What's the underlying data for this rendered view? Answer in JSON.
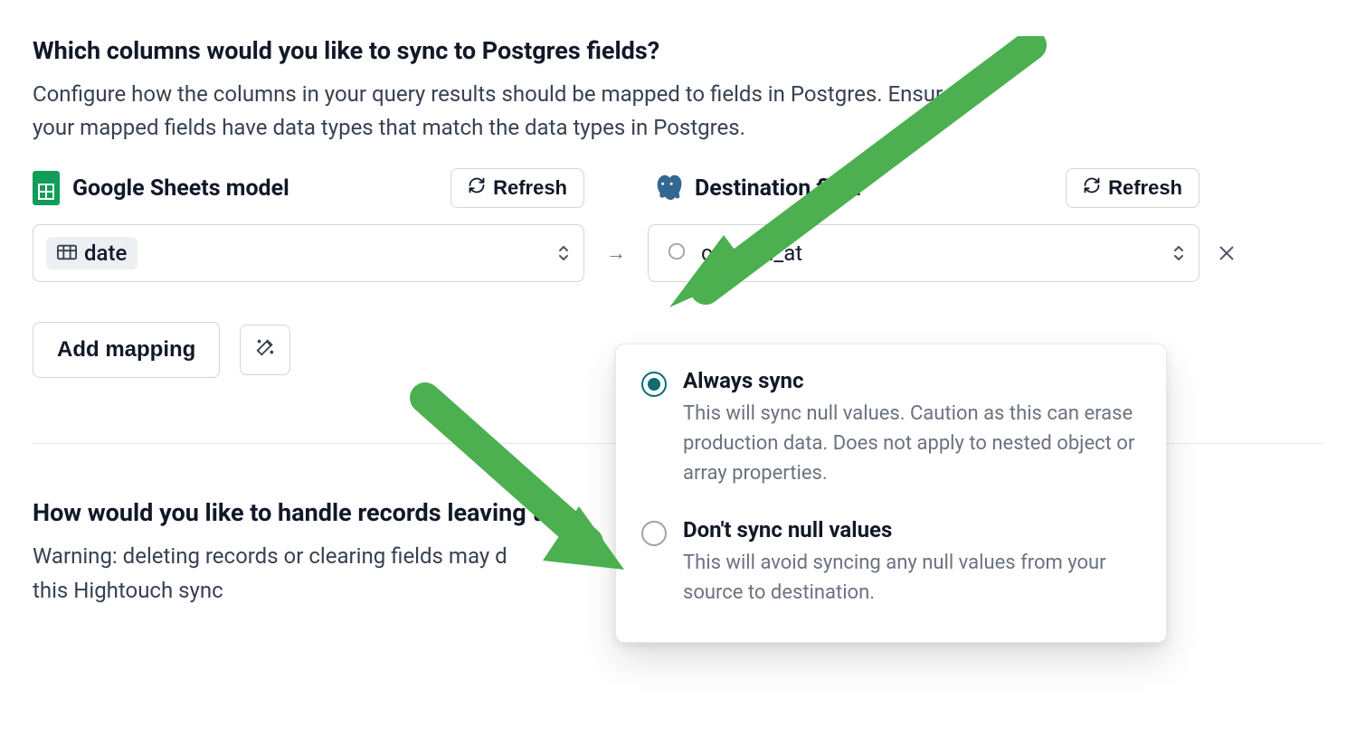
{
  "section1": {
    "heading": "Which columns would you like to sync to Postgres fields?",
    "description": "Configure how the columns in your query results should be mapped to fields in Postgres. Ensure your mapped fields have data types that match the data types in Postgres."
  },
  "source": {
    "label": "Google Sheets model",
    "refresh": "Refresh",
    "selected": "date"
  },
  "destination": {
    "label": "Destination field",
    "refresh": "Refresh",
    "selected": "created_at"
  },
  "actions": {
    "add_mapping": "Add mapping"
  },
  "sync_options": [
    {
      "title": "Always sync",
      "desc": "This will sync null values. Caution as this can erase production data. Does not apply to nested object or array properties.",
      "selected": true
    },
    {
      "title": "Don't sync null values",
      "desc": "This will avoid syncing any null values from your source to destination.",
      "selected": false
    }
  ],
  "section2": {
    "heading": "How would you like to handle records leaving the",
    "warning": "Warning: deleting records or clearing fields may d\nthis Hightouch sync"
  }
}
